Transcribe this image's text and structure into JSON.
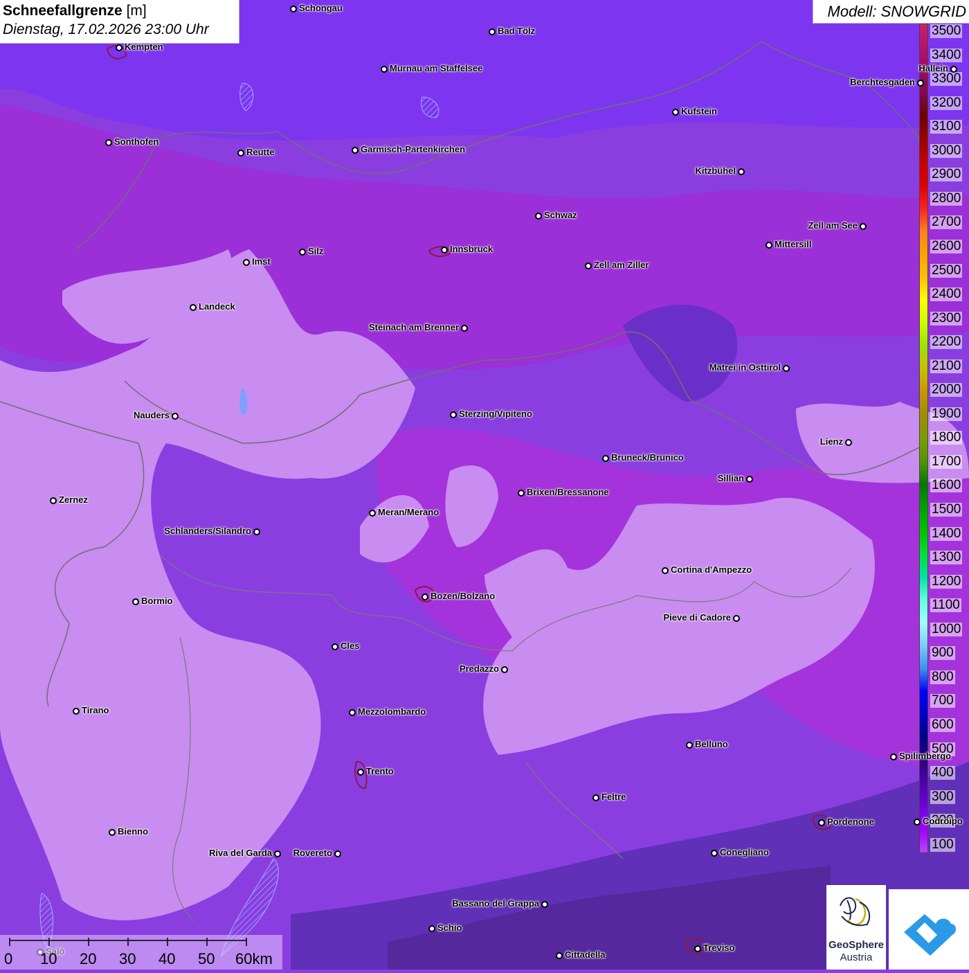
{
  "header": {
    "title": "Schneefallgrenze",
    "unit": "[m]",
    "datetime": "Dienstag, 17.02.2026 23:00 Uhr",
    "model": "Modell: SNOWGRID"
  },
  "legend": {
    "labels": [
      "3500",
      "3400",
      "3300",
      "3200",
      "3100",
      "3000",
      "2900",
      "2800",
      "2700",
      "2600",
      "2500",
      "2400",
      "2300",
      "2200",
      "2100",
      "2000",
      "1900",
      "1800",
      "1700",
      "1600",
      "1500",
      "1400",
      "1300",
      "1200",
      "1100",
      "1000",
      "900",
      "800",
      "700",
      "600",
      "500",
      "400",
      "300",
      "200",
      "100"
    ],
    "colors": [
      "#c81e6e",
      "#b4146e",
      "#9c0a64",
      "#820a50",
      "#6e0000",
      "#a00000",
      "#c80000",
      "#e00000",
      "#ff2020",
      "#ff8020",
      "#ffa000",
      "#ffc000",
      "#ffff00",
      "#c8ff00",
      "#a0e000",
      "#c8c000",
      "#c89600",
      "#a08c00",
      "#7c9c00",
      "#509600",
      "#007800",
      "#00a000",
      "#00c000",
      "#00e030",
      "#00e0a0",
      "#60ffe0",
      "#a0ffff",
      "#80c8ff",
      "#4090f0",
      "#0000ff",
      "#0000c8",
      "#00008c",
      "#300080",
      "#5000b0",
      "#7000e0",
      "#a000ff",
      "#c040ff"
    ]
  },
  "cities": [
    {
      "name": "Schongau"
    },
    {
      "name": "Bad Tölz"
    },
    {
      "name": "Kempten"
    },
    {
      "name": "Murnau am Staffelsee"
    },
    {
      "name": "Hallein"
    },
    {
      "name": "Berchtesgaden"
    },
    {
      "name": "Kufstein"
    },
    {
      "name": "Sonthofen"
    },
    {
      "name": "Reutte"
    },
    {
      "name": "Garmisch-Partenkirchen"
    },
    {
      "name": "Kitzbühel"
    },
    {
      "name": "Schwaz"
    },
    {
      "name": "Zell am See"
    },
    {
      "name": "Mittersill"
    },
    {
      "name": "Silz"
    },
    {
      "name": "Innsbruck"
    },
    {
      "name": "Imst"
    },
    {
      "name": "Zell am Ziller"
    },
    {
      "name": "Landeck"
    },
    {
      "name": "Steinach am Brenner"
    },
    {
      "name": "Matrei in Osttirol"
    },
    {
      "name": "Nauders"
    },
    {
      "name": "Sterzing/Vipiteno"
    },
    {
      "name": "Lienz"
    },
    {
      "name": "Bruneck/Brunico"
    },
    {
      "name": "Sillian"
    },
    {
      "name": "Zernez"
    },
    {
      "name": "Brixen/Bressanone"
    },
    {
      "name": "Meran/Merano"
    },
    {
      "name": "Schlanders/Silandro"
    },
    {
      "name": "Cortina d'Ampezzo"
    },
    {
      "name": "Bozen/Bolzano"
    },
    {
      "name": "Bormio"
    },
    {
      "name": "Pieve di Cadore"
    },
    {
      "name": "Cles"
    },
    {
      "name": "Predazzo"
    },
    {
      "name": "Tirano"
    },
    {
      "name": "Mezzolombardo"
    },
    {
      "name": "Belluno"
    },
    {
      "name": "Spilimbergo"
    },
    {
      "name": "Trento"
    },
    {
      "name": "Feltre"
    },
    {
      "name": "Pordenone"
    },
    {
      "name": "Codroipo"
    },
    {
      "name": "Bienno"
    },
    {
      "name": "Riva del Garda"
    },
    {
      "name": "Rovereto"
    },
    {
      "name": "Conegliano"
    },
    {
      "name": "Bassano del Grappa"
    },
    {
      "name": "Schio"
    },
    {
      "name": "Treviso"
    },
    {
      "name": "Salò"
    },
    {
      "name": "Cittadella"
    }
  ],
  "scale": {
    "ticks": [
      "0",
      "10",
      "20",
      "30",
      "40",
      "50",
      "60km"
    ]
  },
  "logos": {
    "geosphere_line1": "GeoSphere",
    "geosphere_line2": "Austria"
  },
  "colors": {
    "low": "#c98cf0",
    "mid": "#8a3ee0",
    "purple": "#9b2fd8",
    "dark": "#5a2aa8"
  }
}
